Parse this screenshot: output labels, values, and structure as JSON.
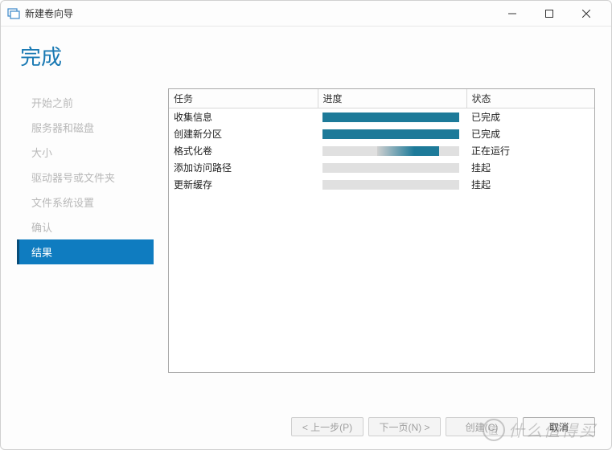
{
  "window": {
    "title": "新建卷向导"
  },
  "page": {
    "title": "完成"
  },
  "sidebar": {
    "items": [
      {
        "label": "开始之前",
        "active": false
      },
      {
        "label": "服务器和磁盘",
        "active": false
      },
      {
        "label": "大小",
        "active": false
      },
      {
        "label": "驱动器号或文件夹",
        "active": false
      },
      {
        "label": "文件系统设置",
        "active": false
      },
      {
        "label": "确认",
        "active": false
      },
      {
        "label": "结果",
        "active": true
      }
    ]
  },
  "table": {
    "headers": {
      "task": "任务",
      "progress": "进度",
      "status": "状态"
    },
    "rows": [
      {
        "task": "收集信息",
        "progress_state": "complete",
        "status": "已完成"
      },
      {
        "task": "创建新分区",
        "progress_state": "complete",
        "status": "已完成"
      },
      {
        "task": "格式化卷",
        "progress_state": "indeterminate",
        "status": "正在运行"
      },
      {
        "task": "添加访问路径",
        "progress_state": "pending",
        "status": "挂起"
      },
      {
        "task": "更新缓存",
        "progress_state": "pending",
        "status": "挂起"
      }
    ]
  },
  "buttons": {
    "prev": "< 上一步(P)",
    "next": "下一页(N) >",
    "create": "创建(C)",
    "cancel": "取消"
  },
  "watermark": {
    "circle": "值",
    "text": "什么值得买"
  }
}
